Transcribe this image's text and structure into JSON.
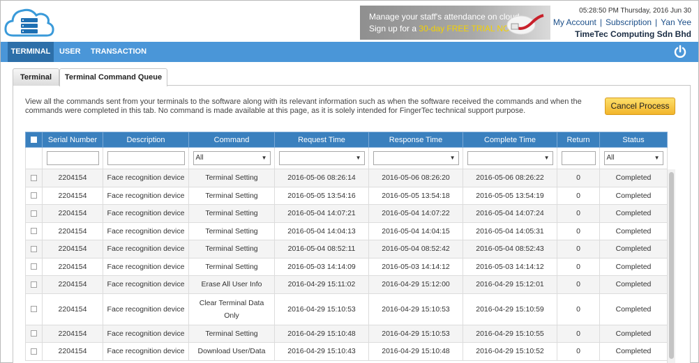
{
  "header": {
    "banner": {
      "line1": "Manage your staff's attendance on cloud",
      "line2_prefix": "Sign up for a ",
      "line2_highlight": "30-day FREE TRIAL NOW!"
    },
    "datetime": "05:28:50 PM Thursday, 2016 Jun 30",
    "links": {
      "my_account": "My Account",
      "subscription": "Subscription",
      "user": "Yan Yee",
      "sep": "|"
    },
    "company": "TimeTec Computing Sdn Bhd"
  },
  "nav": {
    "items": [
      "TERMINAL",
      "USER",
      "TRANSACTION"
    ],
    "active": "TERMINAL"
  },
  "tabs": [
    "Terminal",
    "Terminal Command Queue"
  ],
  "description": "View all the commands sent from your terminals to the software along with its relevant information such as when the software received the commands and when the commands were completed in this tab. No command is made available at this page, as it is solely intended for FingerTec technical support purpose.",
  "cancel_button": "Cancel Process",
  "table": {
    "columns": [
      "Serial Number",
      "Description",
      "Command",
      "Request Time",
      "Response Time",
      "Complete Time",
      "Return",
      "Status"
    ],
    "filters": {
      "command": "All",
      "status": "All"
    },
    "rows": [
      [
        "2204154",
        "Face recognition device",
        "Terminal Setting",
        "2016-05-06 08:26:14",
        "2016-05-06 08:26:20",
        "2016-05-06 08:26:22",
        "0",
        "Completed"
      ],
      [
        "2204154",
        "Face recognition device",
        "Terminal Setting",
        "2016-05-05 13:54:16",
        "2016-05-05 13:54:18",
        "2016-05-05 13:54:19",
        "0",
        "Completed"
      ],
      [
        "2204154",
        "Face recognition device",
        "Terminal Setting",
        "2016-05-04 14:07:21",
        "2016-05-04 14:07:22",
        "2016-05-04 14:07:24",
        "0",
        "Completed"
      ],
      [
        "2204154",
        "Face recognition device",
        "Terminal Setting",
        "2016-05-04 14:04:13",
        "2016-05-04 14:04:15",
        "2016-05-04 14:05:31",
        "0",
        "Completed"
      ],
      [
        "2204154",
        "Face recognition device",
        "Terminal Setting",
        "2016-05-04 08:52:11",
        "2016-05-04 08:52:42",
        "2016-05-04 08:52:43",
        "0",
        "Completed"
      ],
      [
        "2204154",
        "Face recognition device",
        "Terminal Setting",
        "2016-05-03 14:14:09",
        "2016-05-03 14:14:12",
        "2016-05-03 14:14:12",
        "0",
        "Completed"
      ],
      [
        "2204154",
        "Face recognition device",
        "Erase All User Info",
        "2016-04-29 15:11:02",
        "2016-04-29 15:12:00",
        "2016-04-29 15:12:01",
        "0",
        "Completed"
      ],
      [
        "2204154",
        "Face recognition device",
        "Clear Terminal Data Only",
        "2016-04-29 15:10:53",
        "2016-04-29 15:10:53",
        "2016-04-29 15:10:59",
        "0",
        "Completed"
      ],
      [
        "2204154",
        "Face recognition device",
        "Terminal Setting",
        "2016-04-29 15:10:48",
        "2016-04-29 15:10:53",
        "2016-04-29 15:10:55",
        "0",
        "Completed"
      ],
      [
        "2204154",
        "Face recognition device",
        "Download User/Data",
        "2016-04-29 15:10:43",
        "2016-04-29 15:10:48",
        "2016-04-29 15:10:52",
        "0",
        "Completed"
      ]
    ]
  }
}
